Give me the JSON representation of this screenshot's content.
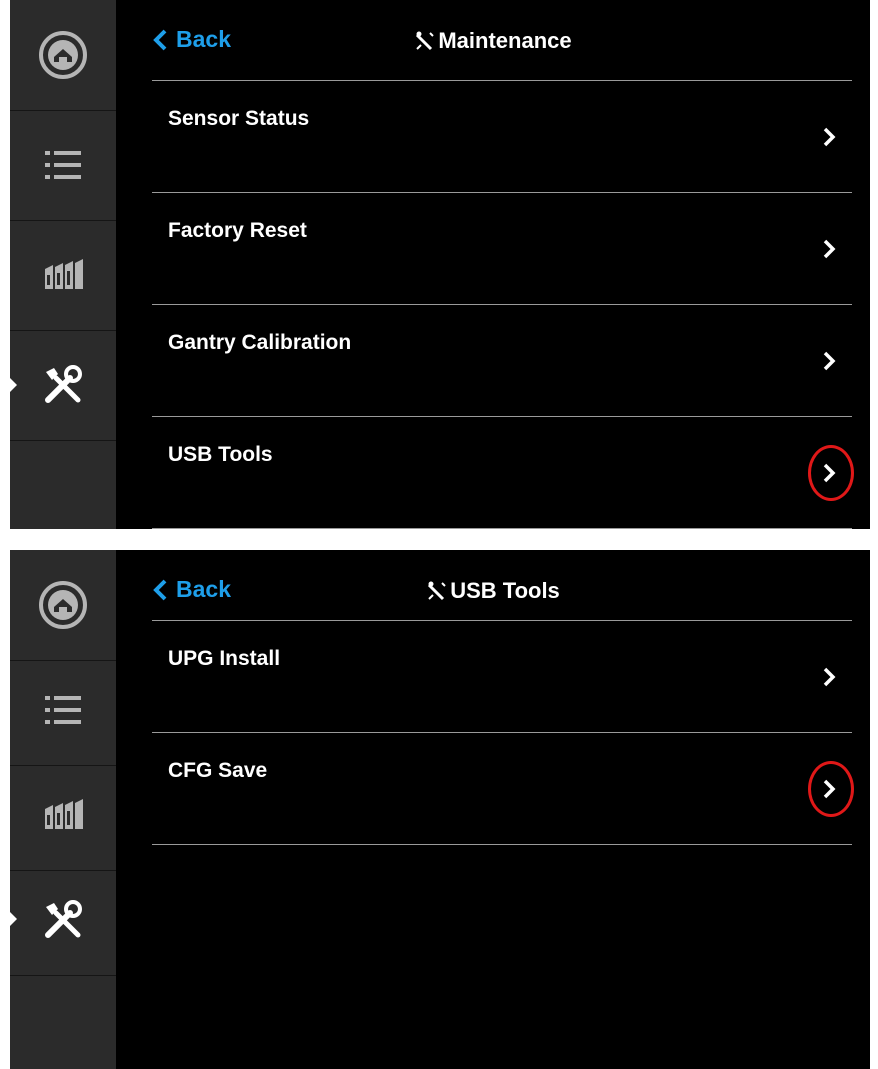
{
  "top_screen": {
    "header": {
      "back_label": "Back",
      "title": "Maintenance"
    },
    "items": [
      {
        "label": "Sensor Status",
        "highlighted": false
      },
      {
        "label": "Factory Reset",
        "highlighted": false
      },
      {
        "label": "Gantry Calibration",
        "highlighted": false
      },
      {
        "label": "USB Tools",
        "highlighted": true
      }
    ]
  },
  "bottom_screen": {
    "header": {
      "back_label": "Back",
      "title": "USB Tools"
    },
    "items": [
      {
        "label": "UPG Install",
        "highlighted": false
      },
      {
        "label": "CFG Save",
        "highlighted": true
      }
    ]
  },
  "sidebar": {
    "items": [
      "home-icon",
      "list-icon",
      "cartridges-icon",
      "tools-icon"
    ],
    "selected": "tools-icon"
  },
  "colors": {
    "accent": "#1e9fea",
    "highlight": "#e01818",
    "sidebar": "#2b2b2b",
    "background": "#000000"
  }
}
